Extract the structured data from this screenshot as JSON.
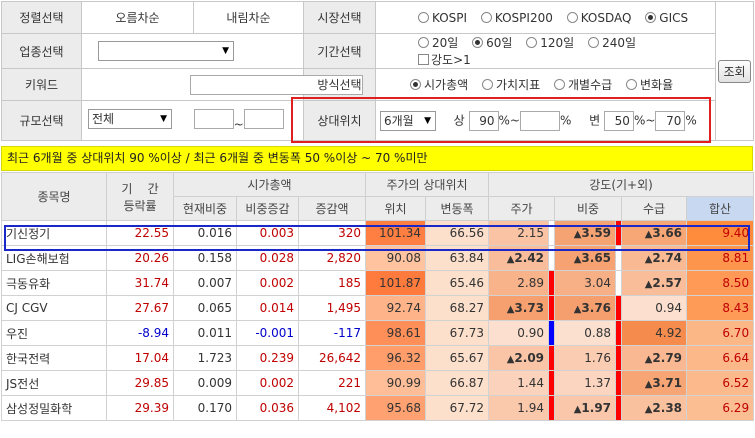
{
  "filter": {
    "sort_label": "정렬선택",
    "sort_asc": "오름차순",
    "sort_desc": "내림차순",
    "market_label": "시장선택",
    "markets": [
      {
        "label": "KOSPI",
        "selected": false
      },
      {
        "label": "KOSPI200",
        "selected": false
      },
      {
        "label": "KOSDAQ",
        "selected": false
      },
      {
        "label": "GICS",
        "selected": true
      }
    ],
    "industry_label": "업종선택",
    "industry_value": "",
    "period_label": "기간선택",
    "periods": [
      {
        "label": "20일",
        "selected": false
      },
      {
        "label": "60일",
        "selected": true
      },
      {
        "label": "120일",
        "selected": false
      },
      {
        "label": "240일",
        "selected": false
      }
    ],
    "strength_check_label": "강도>1",
    "keyword_label": "키워드",
    "keyword_value": "",
    "method_label": "방식선택",
    "methods": [
      {
        "label": "시가총액",
        "selected": true
      },
      {
        "label": "가치지표",
        "selected": false
      },
      {
        "label": "개별수급",
        "selected": false
      },
      {
        "label": "변화율",
        "selected": false
      }
    ],
    "search_button": "조회",
    "size_label": "규모선택",
    "size_value": "전체",
    "size_tilde": "~",
    "relpos_label": "상대위치",
    "relpos_period": "6개월",
    "upper_label": "상",
    "upper_from": "90",
    "upper_pct1": "%~",
    "upper_to": "",
    "upper_pct2": "%",
    "change_label": "변",
    "change_from": "50",
    "change_pct1": "%~",
    "change_to": "70",
    "change_pct2": "%"
  },
  "summary": "최근 6개월 중 상대위치 90 %이상 / 최근 6개월 중 변동폭 50 %이상 ~ 70 %미만",
  "grid": {
    "headers": {
      "name": "종목명",
      "period_return_1": "기    간",
      "period_return_2": "등락률",
      "mcap_group": "시가총액",
      "relpos_group": "주가의 상대위치",
      "strength_group": "강도(기+외)",
      "mcap_ratio": "현재비중",
      "mcap_ratio_chg": "비중증감",
      "mcap_amt_chg": "증감액",
      "position": "위치",
      "range": "변동폭",
      "price": "주가",
      "weight": "비중",
      "flow": "수급",
      "total": "합산"
    },
    "rows": [
      {
        "name": "기신정기",
        "ret": "22.55",
        "ratio": "0.016",
        "ratio_chg": "0.003",
        "amt_chg": "320",
        "pos": "101.34",
        "range": "66.56",
        "price": "2.15",
        "price_up": false,
        "bar1": "#ffffff",
        "weight": "3.59",
        "weight_up": true,
        "bar2": "#ff0000",
        "flow": "3.66",
        "flow_up": true,
        "total": "9.40"
      },
      {
        "name": "LIG손해보험",
        "ret": "20.26",
        "ratio": "0.158",
        "ratio_chg": "0.028",
        "amt_chg": "2,820",
        "pos": "90.08",
        "range": "63.84",
        "price": "2.42",
        "price_up": true,
        "bar1": "#ffffff",
        "weight": "3.65",
        "weight_up": true,
        "bar2": "#ffffff",
        "flow": "2.74",
        "flow_up": true,
        "total": "8.81"
      },
      {
        "name": "극동유화",
        "ret": "31.74",
        "ratio": "0.007",
        "ratio_chg": "0.002",
        "amt_chg": "185",
        "pos": "101.87",
        "range": "65.46",
        "price": "2.89",
        "price_up": false,
        "bar1": "#ff0000",
        "weight": "3.04",
        "weight_up": false,
        "bar2": "#ffffff",
        "flow": "2.57",
        "flow_up": true,
        "total": "8.50"
      },
      {
        "name": "CJ CGV",
        "ret": "27.67",
        "ratio": "0.065",
        "ratio_chg": "0.014",
        "amt_chg": "1,495",
        "pos": "92.74",
        "range": "68.27",
        "price": "3.73",
        "price_up": true,
        "bar1": "#ff0000",
        "weight": "3.76",
        "weight_up": true,
        "bar2": "#ff0000",
        "flow": "0.94",
        "flow_up": false,
        "total": "8.43"
      },
      {
        "name": "우진",
        "ret": "-8.94",
        "ratio": "0.011",
        "ratio_chg": "-0.001",
        "amt_chg": "-117",
        "pos": "98.61",
        "range": "67.73",
        "price": "0.90",
        "price_up": false,
        "bar1": "#0000ff",
        "weight": "0.88",
        "weight_up": false,
        "bar2": "#ff0000",
        "flow": "4.92",
        "flow_up": false,
        "total": "6.70"
      },
      {
        "name": "한국전력",
        "ret": "17.04",
        "ratio": "1.723",
        "ratio_chg": "0.239",
        "amt_chg": "26,642",
        "pos": "96.32",
        "range": "65.67",
        "price": "2.09",
        "price_up": true,
        "bar1": "#ff0000",
        "weight": "1.76",
        "weight_up": false,
        "bar2": "#ff0000",
        "flow": "2.79",
        "flow_up": true,
        "total": "6.64"
      },
      {
        "name": "JS전선",
        "ret": "29.85",
        "ratio": "0.009",
        "ratio_chg": "0.002",
        "amt_chg": "221",
        "pos": "90.99",
        "range": "66.87",
        "price": "1.44",
        "price_up": false,
        "bar1": "#ff0000",
        "weight": "1.37",
        "weight_up": false,
        "bar2": "#ff0000",
        "flow": "3.71",
        "flow_up": true,
        "total": "6.52"
      },
      {
        "name": "삼성정밀화학",
        "ret": "29.39",
        "ratio": "0.170",
        "ratio_chg": "0.036",
        "amt_chg": "4,102",
        "pos": "95.68",
        "range": "67.72",
        "price": "1.94",
        "price_up": false,
        "bar1": "#ff0000",
        "weight": "1.97",
        "weight_up": true,
        "bar2": "#ff0000",
        "flow": "2.38",
        "flow_up": true,
        "total": "6.29"
      }
    ]
  },
  "colors": {
    "pos_strong": "#ff8c5a",
    "range_bg": "#fde0cc",
    "total_bg": "#ff9a55",
    "highlight_border": "#1a28c8",
    "filter_border": "#e02020"
  }
}
